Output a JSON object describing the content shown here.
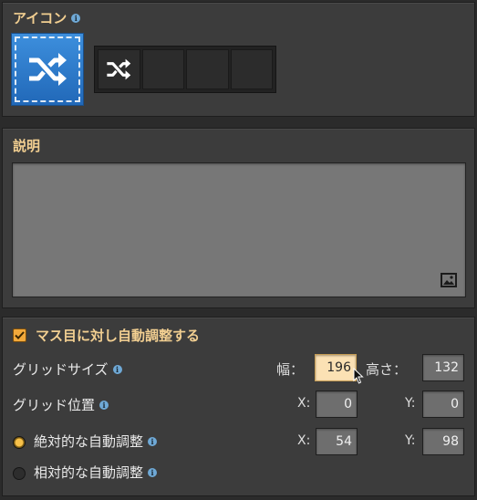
{
  "icon_section": {
    "title": "アイコン",
    "selected_icon": "shuffle-icon",
    "slots": [
      "shuffle-icon",
      "",
      "",
      ""
    ]
  },
  "description_section": {
    "title": "説明",
    "value": "",
    "image_button_icon": "image-icon"
  },
  "auto_adjust": {
    "checkbox_label": "マス目に対し自動調整する",
    "checked": true,
    "grid_size_label": "グリッドサイズ",
    "width_label": "幅：",
    "width_value": "196",
    "height_label": "高さ：",
    "height_value": "132",
    "grid_position_label": "グリッド位置",
    "pos_x_label": "X:",
    "pos_x_value": "0",
    "pos_y_label": "Y:",
    "pos_y_value": "0",
    "absolute_label": "絶対的な自動調整",
    "absolute_selected": true,
    "abs_x_label": "X:",
    "abs_x_value": "54",
    "abs_y_label": "Y:",
    "abs_y_value": "98",
    "relative_label": "相対的な自動調整",
    "info_icon": "info-icon"
  },
  "colors": {
    "section_title": "#f2cf91",
    "accent_blue": "#2f7fd1",
    "checkbox": "#f2a93b",
    "active_field": "#fbe1b4"
  }
}
